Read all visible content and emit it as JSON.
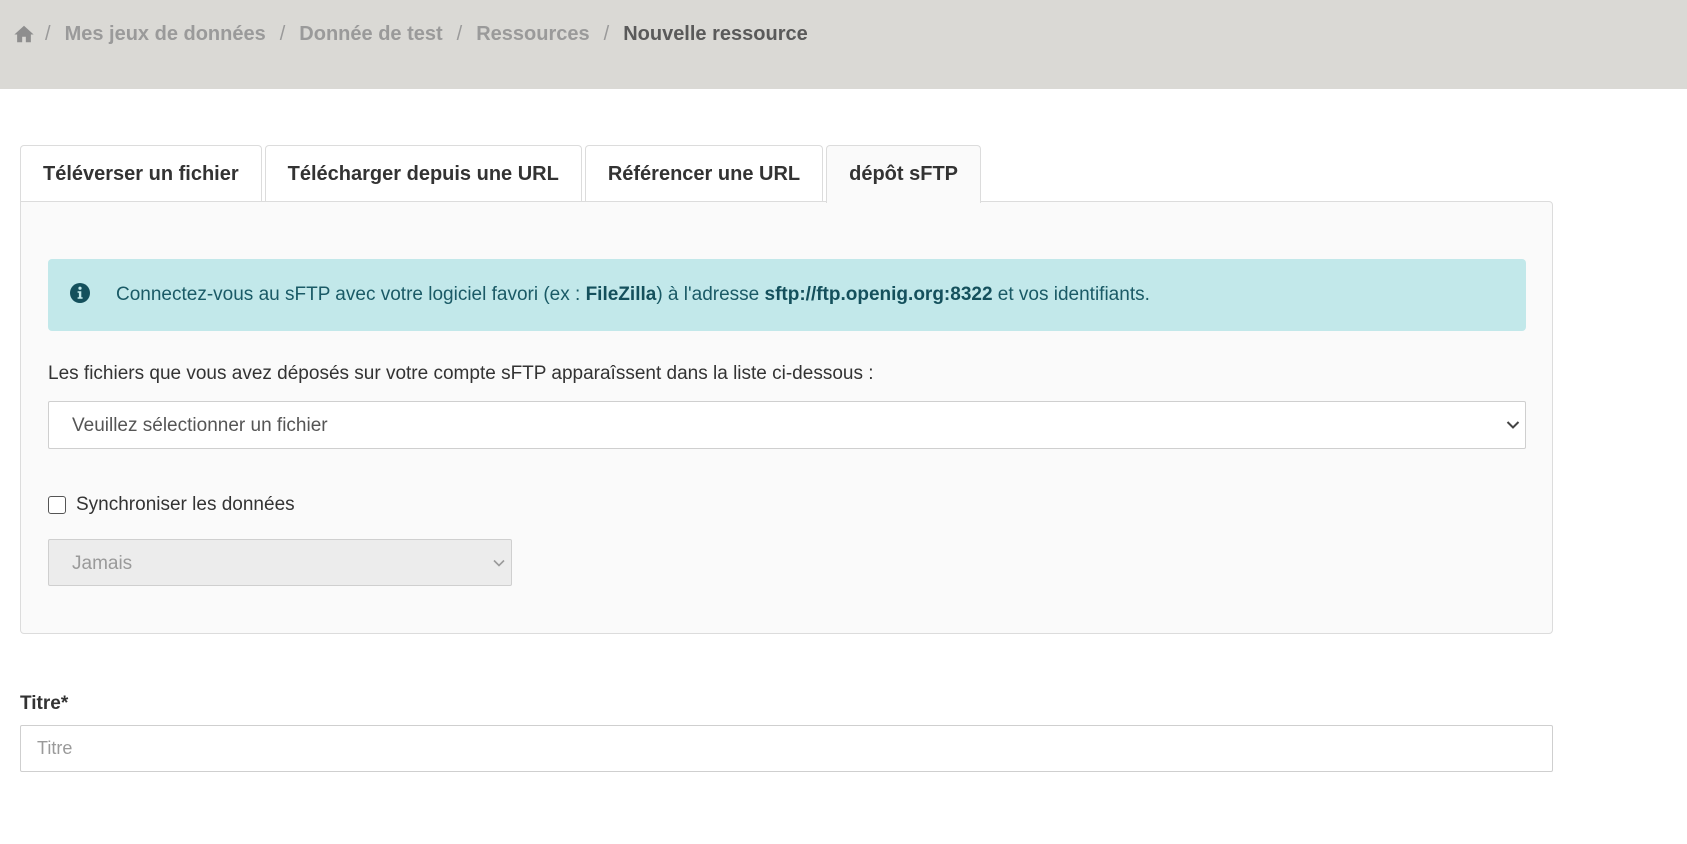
{
  "breadcrumb": {
    "home_icon": "home-icon",
    "separator": "/",
    "items": [
      "Mes jeux de données",
      "Donnée de test",
      "Ressources"
    ],
    "current": "Nouvelle ressource"
  },
  "tabs": [
    {
      "label": "Téléverser un fichier"
    },
    {
      "label": "Télécharger depuis une URL"
    },
    {
      "label": "Référencer une URL"
    },
    {
      "label": "dépôt sFTP"
    }
  ],
  "active_tab": "dépôt sFTP",
  "alert": {
    "icon": "info-circle-icon",
    "text_before": "Connectez-vous au sFTP avec votre logiciel favori (ex : ",
    "software": "FileZilla",
    "text_middle": ") à l'adresse ",
    "address": "sftp://ftp.openig.org:8322",
    "text_after": " et vos identifiants."
  },
  "sftp": {
    "description": "Les fichiers que vous avez déposés sur votre compte sFTP apparaîssent dans la liste ci-dessous :",
    "file_select_value": "Veuillez sélectionner un fichier",
    "sync_label": "Synchroniser les données",
    "sync_checked": false,
    "frequency_value": "Jamais"
  },
  "title_field": {
    "label": "Titre*",
    "placeholder": "Titre"
  },
  "colors": {
    "breadcrumb_bar": "#dad9d5",
    "alert_bg": "#c2e8ea",
    "alert_text": "#1a5a66"
  }
}
